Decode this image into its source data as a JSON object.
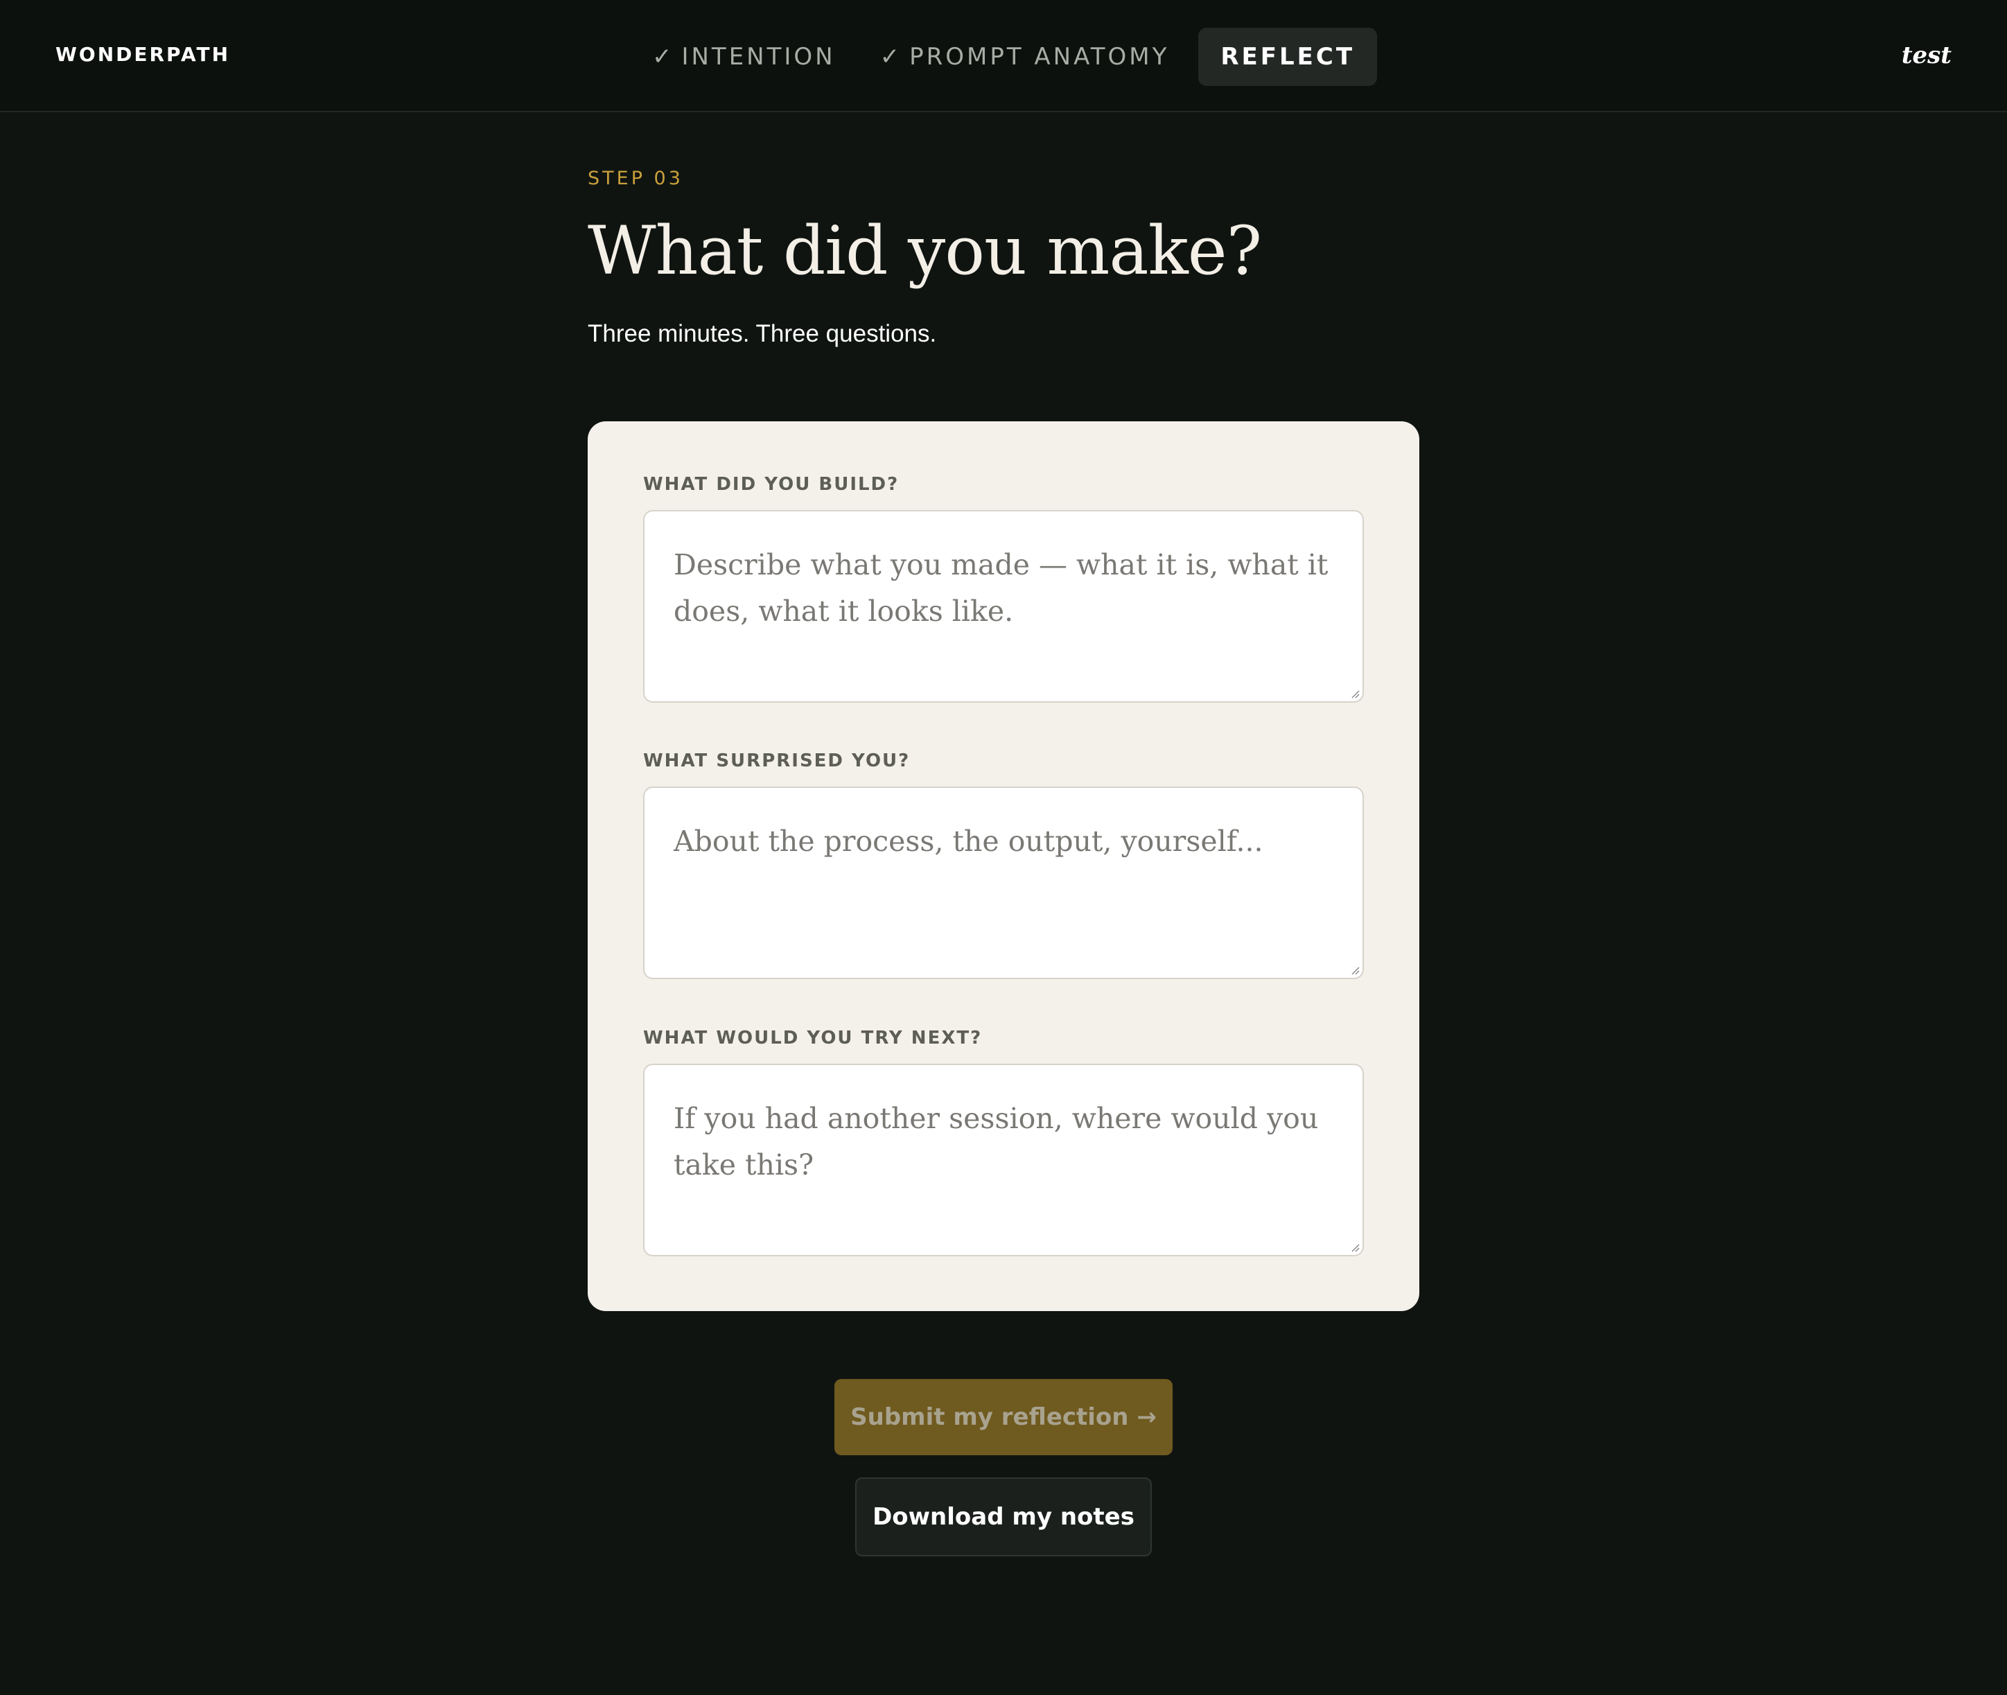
{
  "header": {
    "brand": "WONDERPATH",
    "user": "test",
    "steps": [
      {
        "label": "INTENTION",
        "check": "✓",
        "state": "done"
      },
      {
        "label": "PROMPT ANATOMY",
        "check": "✓",
        "state": "done"
      },
      {
        "label": "REFLECT",
        "state": "active"
      }
    ]
  },
  "page": {
    "eyebrow": "STEP 03",
    "title": "What did you make?",
    "subtitle": "Three minutes. Three questions."
  },
  "form": {
    "fields": [
      {
        "label": "WHAT DID YOU BUILD?",
        "value": "",
        "placeholder": "Describe what you made — what it is, what it does, what it looks like."
      },
      {
        "label": "WHAT SURPRISED YOU?",
        "value": "",
        "placeholder": "About the process, the output, yourself..."
      },
      {
        "label": "WHAT WOULD YOU TRY NEXT?",
        "value": "",
        "placeholder": "If you had another session, where would you take this?"
      }
    ]
  },
  "actions": {
    "submit_label": "Submit my reflection →",
    "download_label": "Download my notes"
  },
  "colors": {
    "background": "#101411",
    "accent": "#c9a03c",
    "card": "#f4f1ea",
    "submit_bg": "#6f5a1f"
  }
}
